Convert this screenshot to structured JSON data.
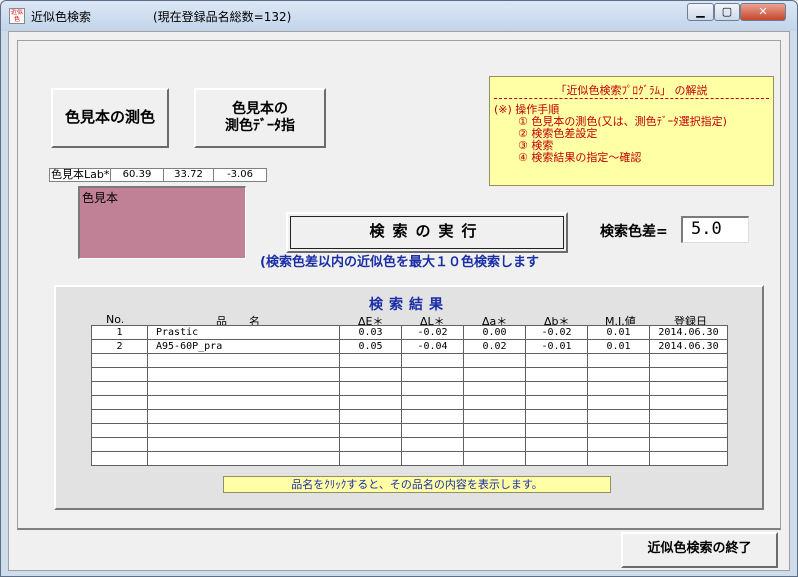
{
  "window": {
    "title": "近似色検索",
    "subtitle": "(現在登録品名総数=132)",
    "icon_text": "近似色",
    "minimize_glyph": "▁",
    "maximize_glyph": "▢",
    "close_glyph": "✕"
  },
  "buttons": {
    "measure": "色見本の測色",
    "data_line1": "色見本の",
    "data_line2": "測色ﾃﾞｰﾀ指",
    "search": "検索の実行",
    "end": "近似色検索の終了"
  },
  "lab": {
    "label": "色見本Lab*",
    "L": "60.39",
    "a": "33.72",
    "b": "-3.06"
  },
  "swatch": {
    "label": "色見本",
    "color": "#c08096"
  },
  "search_info": "(検索色差以内の近似色を最大１０色検索します",
  "tolerance": {
    "label": "検索色差=",
    "value": "5.0"
  },
  "help": {
    "title": "「近似色検索ﾌﾟﾛｸﾞﾗﾑ」 の解説",
    "heading": "(※) 操作手順",
    "steps": [
      "① 色見本の測色(又は、測色ﾃﾞｰﾀ選択指定)",
      "② 検索色差設定",
      "③ 検索",
      "④ 検索結果の指定～確認"
    ]
  },
  "results": {
    "title": "検索結果",
    "columns": [
      "No.",
      "品　　名",
      "ΔE＊",
      "ΔL＊",
      "Δa＊",
      "Δb＊",
      "M.I.値",
      "登録日"
    ],
    "rows": [
      [
        "1",
        "Prastic",
        "0.03",
        "-0.02",
        "0.00",
        "-0.02",
        "0.01",
        "2014.06.30"
      ],
      [
        "2",
        "A95-60P_pra",
        "0.05",
        "-0.04",
        "0.02",
        "-0.01",
        "0.01",
        "2014.06.30"
      ],
      [
        "",
        "",
        "",
        "",
        "",
        "",
        "",
        ""
      ],
      [
        "",
        "",
        "",
        "",
        "",
        "",
        "",
        ""
      ],
      [
        "",
        "",
        "",
        "",
        "",
        "",
        "",
        ""
      ],
      [
        "",
        "",
        "",
        "",
        "",
        "",
        "",
        ""
      ],
      [
        "",
        "",
        "",
        "",
        "",
        "",
        "",
        ""
      ],
      [
        "",
        "",
        "",
        "",
        "",
        "",
        "",
        ""
      ],
      [
        "",
        "",
        "",
        "",
        "",
        "",
        "",
        ""
      ],
      [
        "",
        "",
        "",
        "",
        "",
        "",
        "",
        ""
      ]
    ],
    "hint": "品名をｸﾘｯｸすると、その品名の内容を表示します。"
  }
}
